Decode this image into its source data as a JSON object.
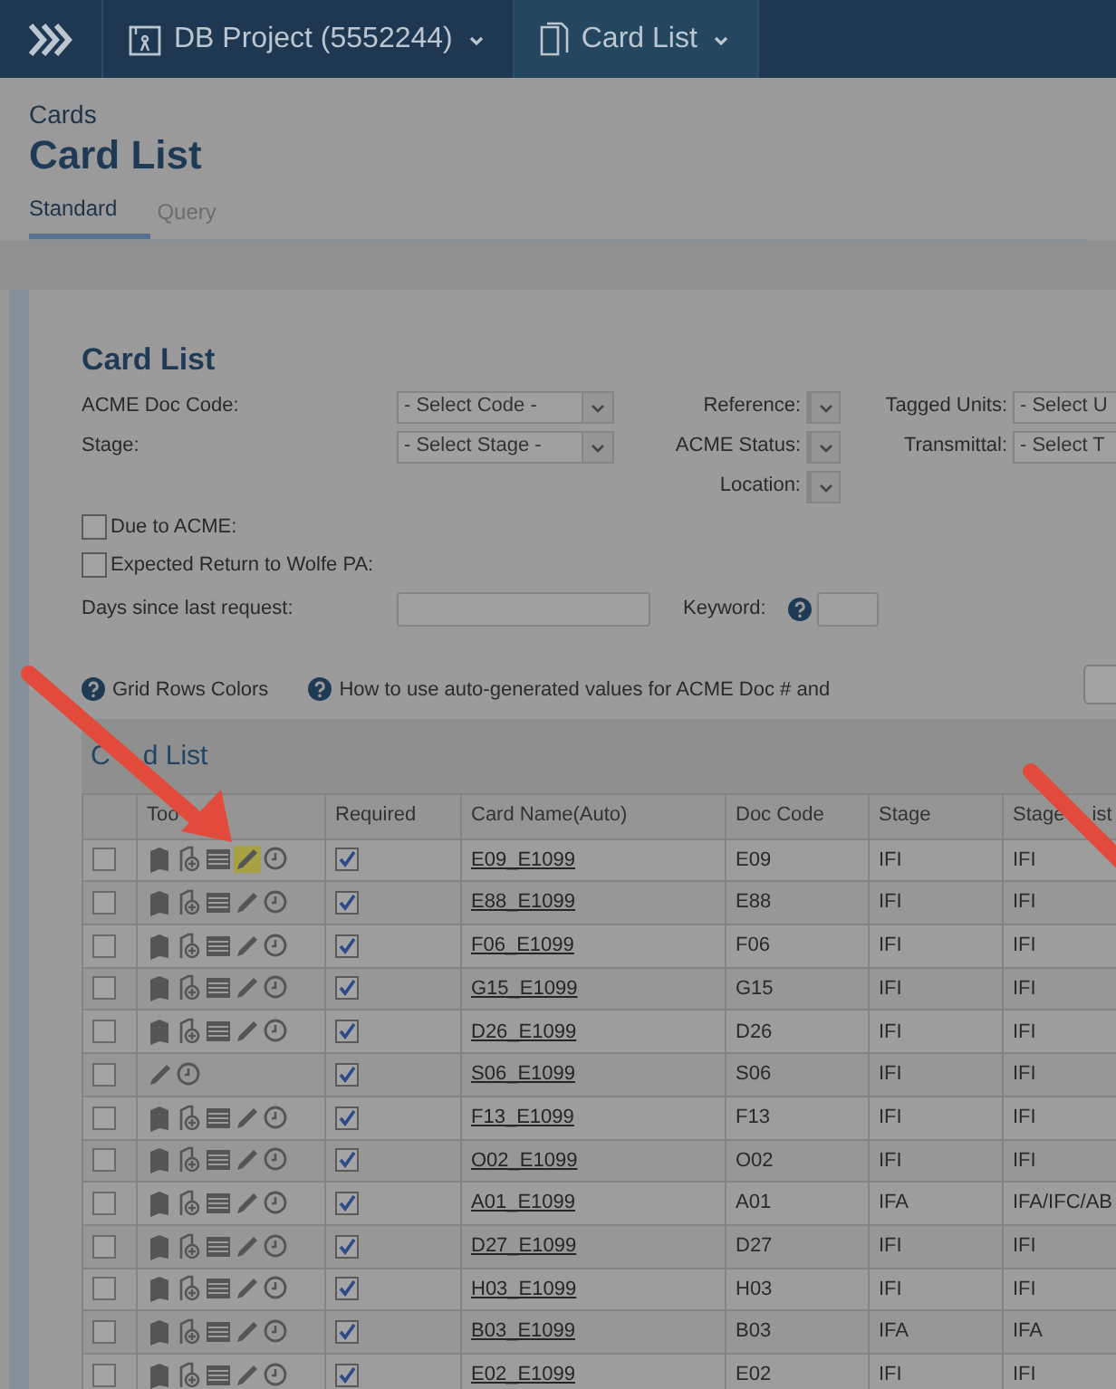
{
  "nav": {
    "project": "DB Project (5552244)",
    "page": "Card List"
  },
  "header": {
    "section": "Cards",
    "title": "Card List",
    "tabs": [
      {
        "label": "Standard",
        "selected": true
      },
      {
        "label": "Query",
        "selected": false
      }
    ]
  },
  "filters": {
    "title": "Card List",
    "rows": [
      {
        "label": "ACME Doc Code:",
        "value": "- Select Code -",
        "cells": [
          {
            "label": "Reference:",
            "kind": "small"
          },
          {
            "label": "Tagged Units:",
            "value": "- Select U",
            "kind": "cut"
          }
        ]
      },
      {
        "label": "Stage:",
        "value": "- Select Stage -",
        "cells": [
          {
            "label": "ACME Status:",
            "kind": "small"
          },
          {
            "label": "Transmittal:",
            "value": "- Select T",
            "kind": "cut"
          }
        ]
      },
      {
        "cells": [
          {
            "label": "Location:",
            "kind": "small"
          }
        ]
      }
    ],
    "checkboxes": [
      {
        "label": "Due to ACME:",
        "checked": false
      },
      {
        "label": "Expected Return to Wolfe PA:",
        "checked": false
      }
    ],
    "days_label": "Days since last request:",
    "keyword_label": "Keyword:"
  },
  "help_links": [
    "Grid Rows Colors",
    "How to use auto-generated values for ACME Doc # and"
  ],
  "table": {
    "title": [
      "C",
      "d List"
    ],
    "columns": [
      {
        "parts": [
          "Too"
        ]
      },
      {
        "parts": [
          "Required"
        ]
      },
      {
        "parts": [
          "Card Name(Auto)"
        ]
      },
      {
        "parts": [
          "Doc Code"
        ]
      },
      {
        "parts": [
          "Stage"
        ]
      },
      {
        "parts": [
          "Stage",
          "ist"
        ]
      }
    ],
    "rows": [
      {
        "selected": false,
        "kind": "full",
        "edit_highlighted": true,
        "required": true,
        "name": "E09_E1099",
        "doc_code": "E09",
        "stage": "IFI",
        "stage_list": "IFI"
      },
      {
        "selected": false,
        "kind": "full",
        "edit_highlighted": false,
        "required": true,
        "name": "E88_E1099",
        "doc_code": "E88",
        "stage": "IFI",
        "stage_list": "IFI"
      },
      {
        "selected": false,
        "kind": "full",
        "edit_highlighted": false,
        "required": true,
        "name": "F06_E1099",
        "doc_code": "F06",
        "stage": "IFI",
        "stage_list": "IFI"
      },
      {
        "selected": false,
        "kind": "full",
        "edit_highlighted": false,
        "required": true,
        "name": "G15_E1099",
        "doc_code": "G15",
        "stage": "IFI",
        "stage_list": "IFI"
      },
      {
        "selected": false,
        "kind": "full",
        "edit_highlighted": false,
        "required": true,
        "name": "D26_E1099",
        "doc_code": "D26",
        "stage": "IFI",
        "stage_list": "IFI"
      },
      {
        "selected": false,
        "kind": "short",
        "edit_highlighted": false,
        "required": true,
        "name": "S06_E1099",
        "doc_code": "S06",
        "stage": "IFI",
        "stage_list": "IFI"
      },
      {
        "selected": false,
        "kind": "full",
        "edit_highlighted": false,
        "required": true,
        "name": "F13_E1099",
        "doc_code": "F13",
        "stage": "IFI",
        "stage_list": "IFI"
      },
      {
        "selected": false,
        "kind": "full",
        "edit_highlighted": false,
        "required": true,
        "name": "O02_E1099",
        "doc_code": "O02",
        "stage": "IFI",
        "stage_list": "IFI"
      },
      {
        "selected": false,
        "kind": "full",
        "edit_highlighted": false,
        "required": true,
        "name": "A01_E1099",
        "doc_code": "A01",
        "stage": "IFA",
        "stage_list": "IFA/IFC/AB"
      },
      {
        "selected": false,
        "kind": "full",
        "edit_highlighted": false,
        "required": true,
        "name": "D27_E1099",
        "doc_code": "D27",
        "stage": "IFI",
        "stage_list": "IFI"
      },
      {
        "selected": false,
        "kind": "full",
        "edit_highlighted": false,
        "required": true,
        "name": "H03_E1099",
        "doc_code": "H03",
        "stage": "IFI",
        "stage_list": "IFI"
      },
      {
        "selected": false,
        "kind": "full",
        "edit_highlighted": false,
        "required": true,
        "name": "B03_E1099",
        "doc_code": "B03",
        "stage": "IFA",
        "stage_list": "IFA"
      },
      {
        "selected": false,
        "kind": "full",
        "edit_highlighted": false,
        "required": true,
        "name": "E02_E1099",
        "doc_code": "E02",
        "stage": "IFI",
        "stage_list": "IFI"
      }
    ]
  },
  "annotations": [
    {
      "kind": "arrow",
      "head": true
    },
    {
      "kind": "arrow",
      "head": false
    }
  ]
}
